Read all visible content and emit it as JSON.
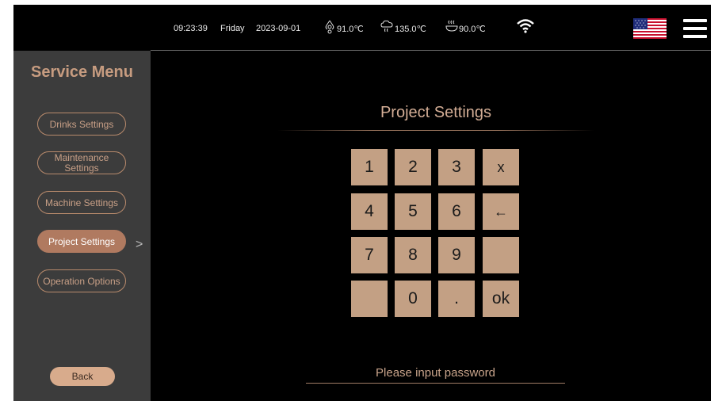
{
  "status_bar": {
    "time": "09:23:39",
    "day": "Friday",
    "date": "2023-09-01",
    "temp_water": "91.0℃",
    "temp_steam": "135.0℃",
    "temp_boiler": "90.0℃",
    "icons": [
      "water-temperature-icon",
      "steam-temperature-icon",
      "boiler-temperature-icon",
      "wifi-icon",
      "us-flag-icon",
      "hamburger-menu-icon"
    ]
  },
  "sidebar": {
    "title": "Service Menu",
    "items": [
      {
        "label": "Drinks Settings"
      },
      {
        "label_line1": "Maintenance",
        "label_line2": "Settings"
      },
      {
        "label": "Machine Settings"
      },
      {
        "label": "Project Settings"
      },
      {
        "label": "Operation Options"
      }
    ],
    "active_item": "Project Settings",
    "back_label": "Back",
    "chevron": ">"
  },
  "main": {
    "title": "Project Settings",
    "keypad": [
      [
        "1",
        "2",
        "3",
        "x"
      ],
      [
        "4",
        "5",
        "6",
        "←"
      ],
      [
        "7",
        "8",
        "9",
        ""
      ],
      [
        "",
        "0",
        ".",
        "ok"
      ]
    ],
    "password_placeholder": "Please input password"
  },
  "colors": {
    "accent": "#c3a084",
    "sidebar_bg": "#3c3c3c",
    "active_item": "#b07a60",
    "background": "#000000"
  }
}
